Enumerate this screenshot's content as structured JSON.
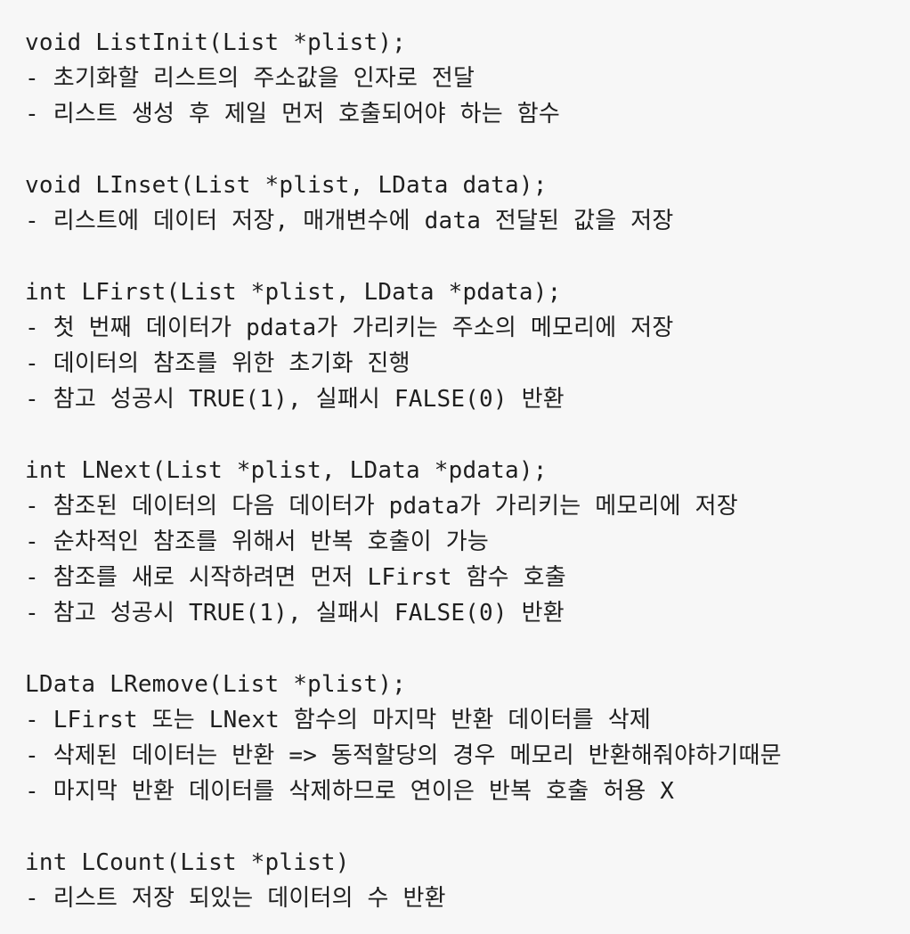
{
  "lines": [
    "void ListInit(List *plist);",
    "- 초기화할 리스트의 주소값을 인자로 전달",
    "- 리스트 생성 후 제일 먼저 호출되어야 하는 함수",
    "",
    "void LInset(List *plist, LData data);",
    "- 리스트에 데이터 저장, 매개변수에 data 전달된 값을 저장",
    "",
    "int LFirst(List *plist, LData *pdata);",
    "- 첫 번째 데이터가 pdata가 가리키는 주소의 메모리에 저장",
    "- 데이터의 참조를 위한 초기화 진행",
    "- 참고 성공시 TRUE(1), 실패시 FALSE(0) 반환",
    "",
    "int LNext(List *plist, LData *pdata);",
    "- 참조된 데이터의 다음 데이터가 pdata가 가리키는 메모리에 저장",
    "- 순차적인 참조를 위해서 반복 호출이 가능",
    "- 참조를 새로 시작하려면 먼저 LFirst 함수 호출",
    "- 참고 성공시 TRUE(1), 실패시 FALSE(0) 반환",
    "",
    "LData LRemove(List *plist);",
    "- LFirst 또는 LNext 함수의 마지막 반환 데이터를 삭제",
    "- 삭제된 데이터는 반환 => 동적할당의 경우 메모리 반환해줘야하기때문",
    "- 마지막 반환 데이터를 삭제하므로 연이은 반복 호출 허용 X",
    "",
    "int LCount(List *plist)",
    "- 리스트 저장 되있는 데이터의 수 반환"
  ]
}
